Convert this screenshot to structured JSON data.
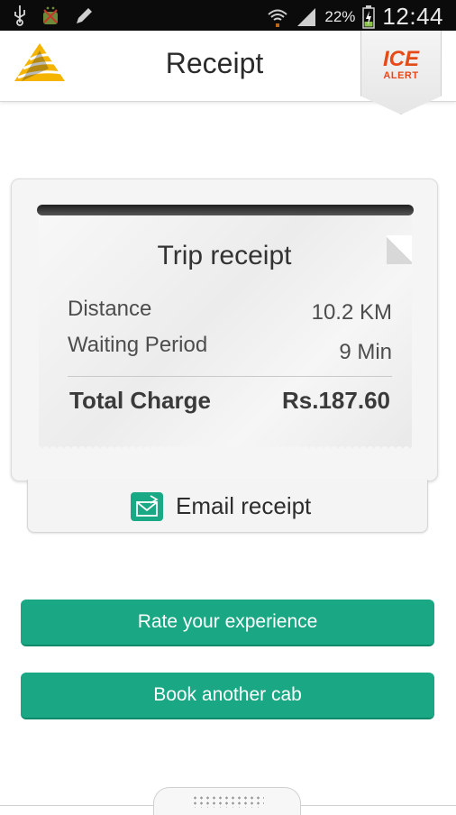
{
  "status_bar": {
    "icons": [
      "usb-icon",
      "android-debug-icon",
      "edit-icon",
      "wifi-icon",
      "signal-icon",
      "battery-charging-icon"
    ],
    "battery_percent": "22%",
    "time": "12:44"
  },
  "header": {
    "title": "Receipt",
    "ice_alert": {
      "line1": "ICE",
      "line2": "ALERT"
    }
  },
  "receipt": {
    "title": "Trip receipt",
    "rows": [
      {
        "label": "Distance",
        "value": "10.2 KM"
      },
      {
        "label": "Waiting Period",
        "value": "9 Min"
      }
    ],
    "total": {
      "label": "Total Charge",
      "value": "Rs.187.60"
    }
  },
  "email_button": {
    "label": "Email receipt",
    "icon": "email-icon"
  },
  "buttons": {
    "rate": "Rate your experience",
    "book": "Book another cab"
  },
  "colors": {
    "accent_green": "#19a784",
    "ice_orange": "#e64a19",
    "logo_gold": "#f5b400"
  }
}
